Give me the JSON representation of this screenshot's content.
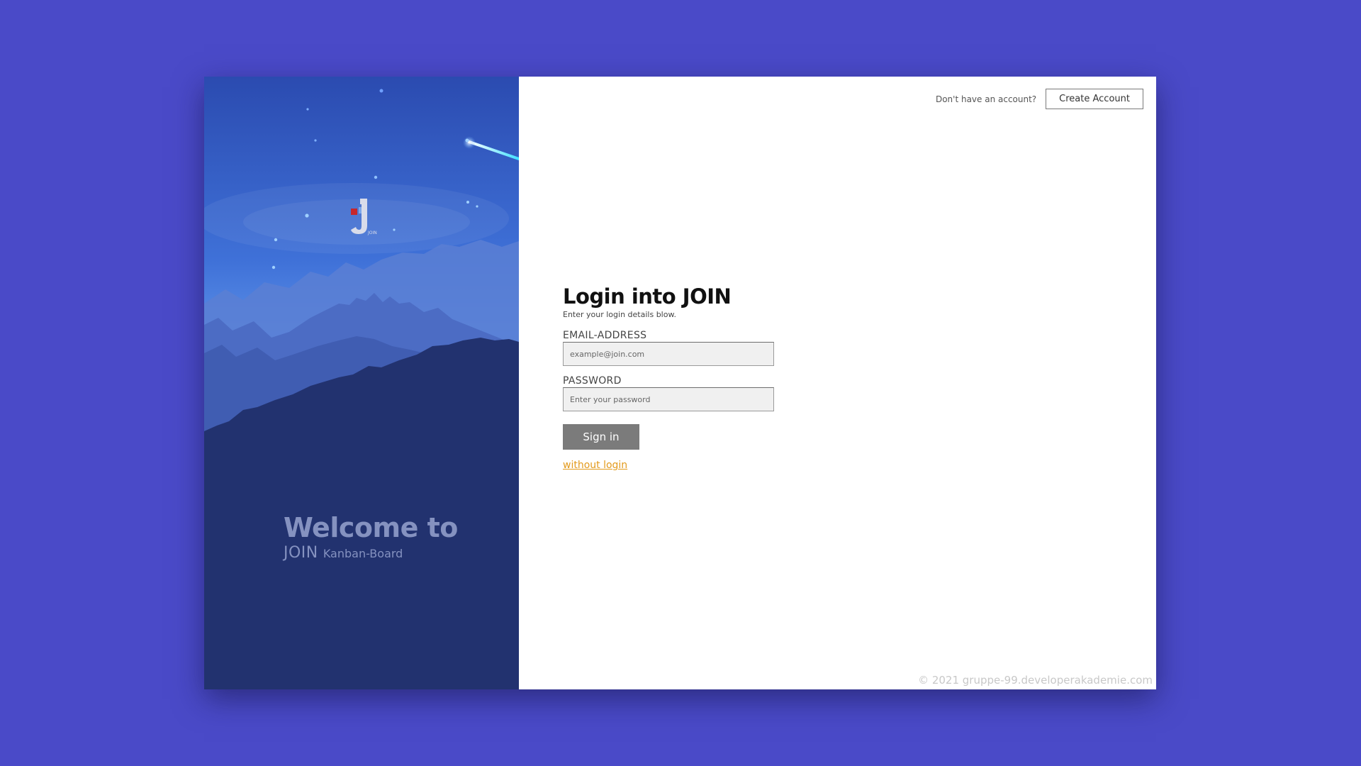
{
  "left_panel": {
    "welcome_title": "Welcome to",
    "welcome_brand": "JOIN",
    "welcome_subtitle": "Kanban-Board",
    "logo_caption": "JOIN"
  },
  "header": {
    "question": "Don't have an account?",
    "create_account_label": "Create Account"
  },
  "login_form": {
    "title": "Login into JOIN",
    "subtitle": "Enter your login details blow.",
    "email_label": "EMAIL-ADDRESS",
    "email_placeholder": "example@join.com",
    "email_value": "",
    "password_label": "PASSWORD",
    "password_placeholder": "Enter your password",
    "password_value": "",
    "sign_in_label": "Sign in",
    "without_login_label": "without login"
  },
  "footer": {
    "copyright": "© 2021 gruppe-99.developerakademie.com"
  },
  "colors": {
    "page_background": "#4a4ac8",
    "panel_dark": "#22326f",
    "accent_link": "#e39a1c",
    "button_gray": "#7b7b7b"
  }
}
